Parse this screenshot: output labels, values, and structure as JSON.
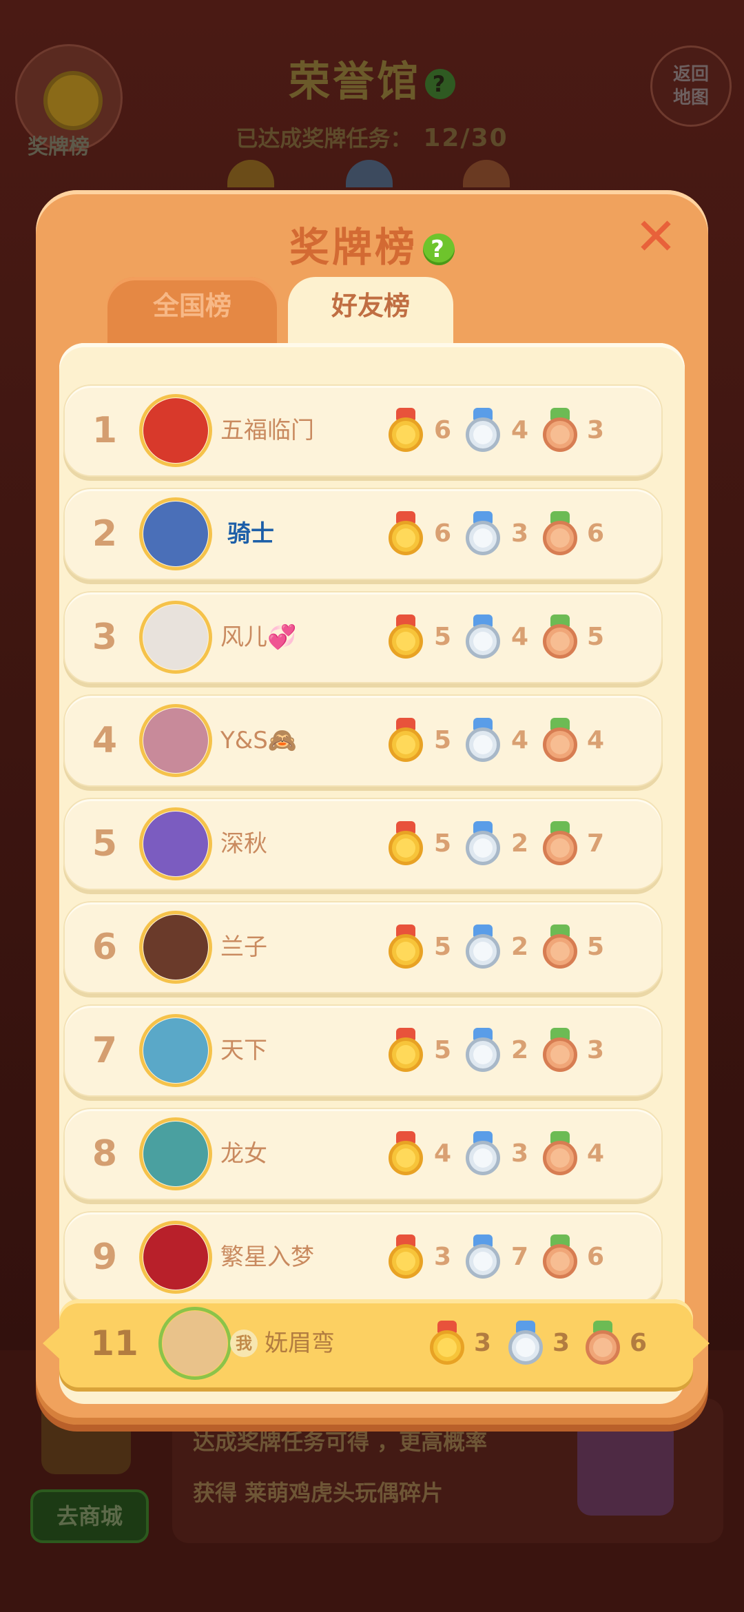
{
  "background": {
    "title": "荣誉馆",
    "help_glyph": "?",
    "progress_label": "已达成奖牌任务：",
    "progress_value": "12/30",
    "medal_button_label": "奖牌榜",
    "back_button_label": "返回地图",
    "bottom_line1": "达成奖牌任务可得 ，更高概率",
    "bottom_line2": "获得 莱萌鸡虎头玩偶碎片",
    "shop_button_label": "去商城"
  },
  "modal": {
    "title": "奖牌榜",
    "help_glyph": "?",
    "close_glyph": "✕",
    "tabs": [
      {
        "label": "全国榜",
        "active": false
      },
      {
        "label": "好友榜",
        "active": true
      }
    ]
  },
  "leaderboard": [
    {
      "rank": "1",
      "name": "五福临门",
      "gold": "6",
      "silver": "4",
      "bronze": "3",
      "avatar_color": "#d8392b"
    },
    {
      "rank": "2",
      "name": "骑士",
      "gold": "6",
      "silver": "3",
      "bronze": "6",
      "avatar_color": "#4a6fb8"
    },
    {
      "rank": "3",
      "name": "风儿💞",
      "gold": "5",
      "silver": "4",
      "bronze": "5",
      "avatar_color": "#e8e2dc"
    },
    {
      "rank": "4",
      "name": "Y&S🙈",
      "gold": "5",
      "silver": "4",
      "bronze": "4",
      "avatar_color": "#c88a9a"
    },
    {
      "rank": "5",
      "name": "深秋",
      "gold": "5",
      "silver": "2",
      "bronze": "7",
      "avatar_color": "#7b5cc0"
    },
    {
      "rank": "6",
      "name": "兰子",
      "gold": "5",
      "silver": "2",
      "bronze": "5",
      "avatar_color": "#6a3a2a"
    },
    {
      "rank": "7",
      "name": "天下",
      "gold": "5",
      "silver": "2",
      "bronze": "3",
      "avatar_color": "#5aa8c8"
    },
    {
      "rank": "8",
      "name": "龙女",
      "gold": "4",
      "silver": "3",
      "bronze": "4",
      "avatar_color": "#4aa0a0"
    },
    {
      "rank": "9",
      "name": "繁星入梦",
      "gold": "3",
      "silver": "7",
      "bronze": "6",
      "avatar_color": "#b8202a"
    }
  ],
  "self": {
    "rank": "11",
    "me_badge": "我",
    "name": "妩眉弯",
    "gold": "3",
    "silver": "3",
    "bronze": "6",
    "avatar_color": "#e9c28a"
  },
  "colors": {
    "modal_bg": "#f0a25d",
    "panel_bg": "#fdf1cf",
    "self_row_bg": "#fcd062",
    "rank_text": "#d49e70",
    "title_text": "#d36a33"
  }
}
